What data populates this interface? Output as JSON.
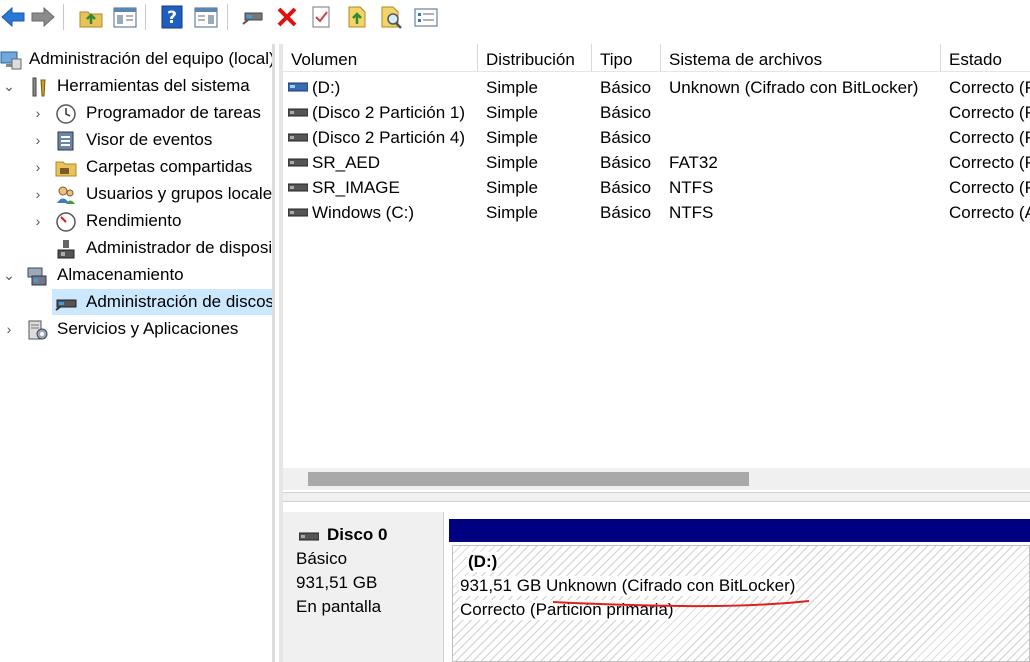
{
  "toolbar": {
    "buttons": [
      {
        "name": "back-button",
        "icon": "back-arrow-icon"
      },
      {
        "name": "forward-button",
        "icon": "forward-arrow-icon"
      },
      {
        "name": "up-folder-button",
        "icon": "up-folder-icon"
      },
      {
        "name": "show-hide-console-tree-button",
        "icon": "console-tree-icon"
      },
      {
        "name": "help-button",
        "icon": "help-icon"
      },
      {
        "name": "show-hide-action-pane-button",
        "icon": "action-pane-icon"
      },
      {
        "name": "connect-virtual-disk-button",
        "icon": "disk-connect-icon"
      },
      {
        "name": "delete-button",
        "icon": "delete-x-icon"
      },
      {
        "name": "check-button",
        "icon": "check-document-icon"
      },
      {
        "name": "export-button",
        "icon": "export-icon"
      },
      {
        "name": "search-button",
        "icon": "magnify-document-icon"
      },
      {
        "name": "properties-button",
        "icon": "properties-list-icon"
      }
    ]
  },
  "tree": {
    "root": {
      "label": "Administración del equipo (local)",
      "icon": "computer-management-icon"
    },
    "items": [
      {
        "label": "Herramientas del sistema",
        "icon": "tools-icon",
        "chevron": "expanded",
        "level": 1
      },
      {
        "label": "Programador de tareas",
        "icon": "clock-icon",
        "chevron": "collapsed",
        "level": 2
      },
      {
        "label": "Visor de eventos",
        "icon": "event-viewer-icon",
        "chevron": "collapsed",
        "level": 2
      },
      {
        "label": "Carpetas compartidas",
        "icon": "shared-folder-icon",
        "chevron": "collapsed",
        "level": 2
      },
      {
        "label": "Usuarios y grupos locales",
        "icon": "users-icon",
        "chevron": "collapsed",
        "level": 2
      },
      {
        "label": "Rendimiento",
        "icon": "performance-icon",
        "chevron": "collapsed",
        "level": 2
      },
      {
        "label": "Administrador de dispositivos",
        "icon": "device-manager-icon",
        "chevron": "none",
        "level": 2
      },
      {
        "label": "Almacenamiento",
        "icon": "storage-icon",
        "chevron": "expanded",
        "level": 1
      },
      {
        "label": "Administración de discos",
        "icon": "disk-management-icon",
        "chevron": "none",
        "level": 2,
        "selected": true
      },
      {
        "label": "Servicios y Aplicaciones",
        "icon": "services-icon",
        "chevron": "collapsed",
        "level": 1
      }
    ]
  },
  "volume_list": {
    "columns": [
      "Volumen",
      "Distribución",
      "Tipo",
      "Sistema de archivos",
      "Estado"
    ],
    "rows": [
      {
        "volume": "(D:)",
        "layout": "Simple",
        "type": "Básico",
        "fs": "Unknown (Cifrado con BitLocker)",
        "status": "Correcto (P",
        "icon": "bitlocker-drive-icon"
      },
      {
        "volume": "(Disco 2 Partición 1)",
        "layout": "Simple",
        "type": "Básico",
        "fs": "",
        "status": "Correcto (P",
        "icon": "drive-icon"
      },
      {
        "volume": "(Disco 2 Partición 4)",
        "layout": "Simple",
        "type": "Básico",
        "fs": "",
        "status": "Correcto (P",
        "icon": "drive-icon"
      },
      {
        "volume": "SR_AED",
        "layout": "Simple",
        "type": "Básico",
        "fs": "FAT32",
        "status": "Correcto (P",
        "icon": "drive-icon"
      },
      {
        "volume": "SR_IMAGE",
        "layout": "Simple",
        "type": "Básico",
        "fs": "NTFS",
        "status": "Correcto (P",
        "icon": "drive-icon"
      },
      {
        "volume": "Windows (C:)",
        "layout": "Simple",
        "type": "Básico",
        "fs": "NTFS",
        "status": "Correcto (A",
        "icon": "drive-icon"
      }
    ]
  },
  "disk_map": {
    "disk": {
      "name": "Disco 0",
      "type": "Básico",
      "size": "931,51 GB",
      "state": "En pantalla",
      "icon": "disk-icon"
    },
    "partition": {
      "label": "(D:)",
      "size_fs": "931,51 GB Unknown (Cifrado con BitLocker)",
      "status": "Correcto (Partición primaria)"
    },
    "colors": {
      "partition_bar": "#000080",
      "annotation_underline": "#e02020",
      "selection": "#cce8ff"
    }
  }
}
